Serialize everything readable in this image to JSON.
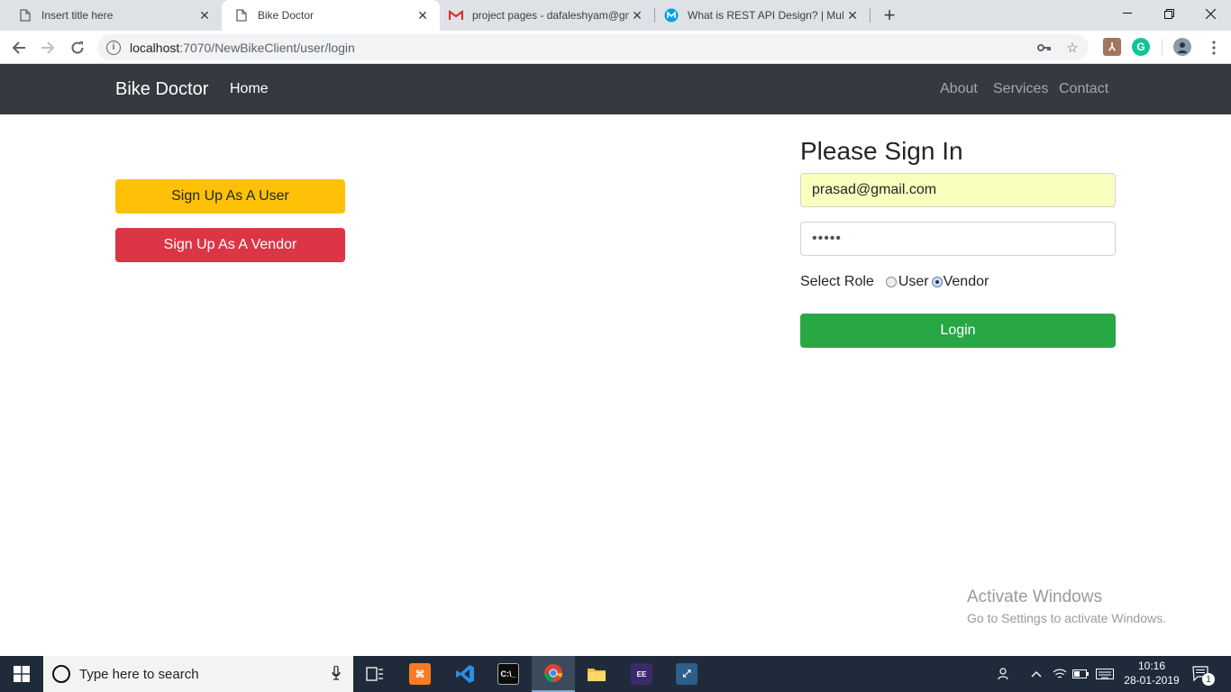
{
  "browser": {
    "tabs": [
      {
        "label": "Insert title here",
        "icon": "page-icon"
      },
      {
        "label": "Bike Doctor",
        "icon": "page-icon"
      },
      {
        "label": "project pages - dafaleshyam@gm",
        "icon": "gmail-icon"
      },
      {
        "label": "What is REST API Design? | Mule",
        "icon": "mulesoft-icon"
      }
    ],
    "active_tab": 1,
    "url_host": "localhost",
    "url_rest": ":7070/NewBikeClient/user/login"
  },
  "navbar": {
    "brand": "Bike Doctor",
    "home": "Home",
    "links": [
      "About",
      "Services",
      "Contact"
    ]
  },
  "signup": {
    "user_label": "Sign Up As A User",
    "vendor_label": "Sign Up As A Vendor"
  },
  "signin": {
    "title": "Please Sign In",
    "email_value": "prasad@gmail.com",
    "password_value": "•••••",
    "role_label": "Select Role",
    "role_options": [
      "User",
      "Vendor"
    ],
    "role_selected": "Vendor",
    "login_label": "Login"
  },
  "watermark": {
    "line1": "Activate Windows",
    "line2": "Go to Settings to activate Windows."
  },
  "taskbar": {
    "search_placeholder": "Type here to search",
    "time": "10:16",
    "date": "28-01-2019",
    "notification_count": "1"
  },
  "colors": {
    "navbar_bg": "#343a40",
    "warning": "#ffc107",
    "danger": "#dc3545",
    "success": "#28a745",
    "autofill": "#faffbd"
  }
}
